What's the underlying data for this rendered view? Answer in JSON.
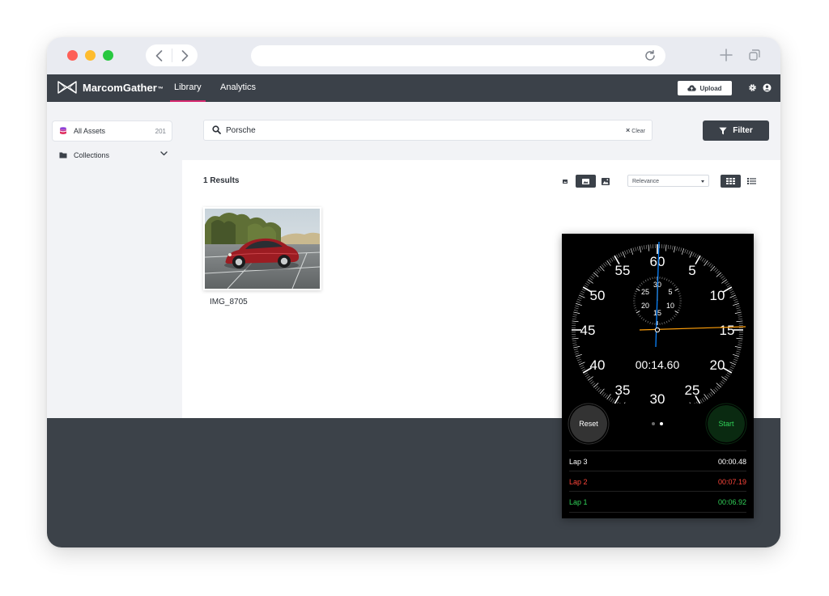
{
  "app": {
    "brand": "MarcomGather",
    "brand_tm": "™",
    "nav": [
      {
        "label": "Library",
        "active": true
      },
      {
        "label": "Analytics",
        "active": false
      }
    ],
    "upload_label": "Upload",
    "accent_color": "#d6286f"
  },
  "browser": {
    "traffic_lights": [
      "#fe5f57",
      "#febc2e",
      "#28c840"
    ]
  },
  "sidebar": {
    "items": [
      {
        "label": "All Assets",
        "count": "201",
        "icon": "database-icon",
        "active": true
      },
      {
        "label": "Collections",
        "icon": "folder-icon",
        "active": false
      }
    ]
  },
  "search": {
    "value": "Porsche",
    "clear_label": "Clear",
    "filter_label": "Filter"
  },
  "results": {
    "count_label": "1 Results",
    "sort_value": "Relevance",
    "assets": [
      {
        "name": "IMG_8705"
      }
    ]
  },
  "stopwatch": {
    "dial_numbers": [
      "60",
      "5",
      "10",
      "15",
      "20",
      "25",
      "30",
      "35",
      "40",
      "45",
      "50",
      "55"
    ],
    "subdial_numbers": [
      "30",
      "5",
      "10",
      "15",
      "20",
      "25"
    ],
    "elapsed": "00:14.60",
    "reset_label": "Reset",
    "start_label": "Start",
    "laps": [
      {
        "label": "Lap 3",
        "time": "00:00.48",
        "color": "#ffffff"
      },
      {
        "label": "Lap 2",
        "time": "00:07.19",
        "color": "#ff453a"
      },
      {
        "label": "Lap 1",
        "time": "00:06.92",
        "color": "#30d158"
      }
    ]
  }
}
